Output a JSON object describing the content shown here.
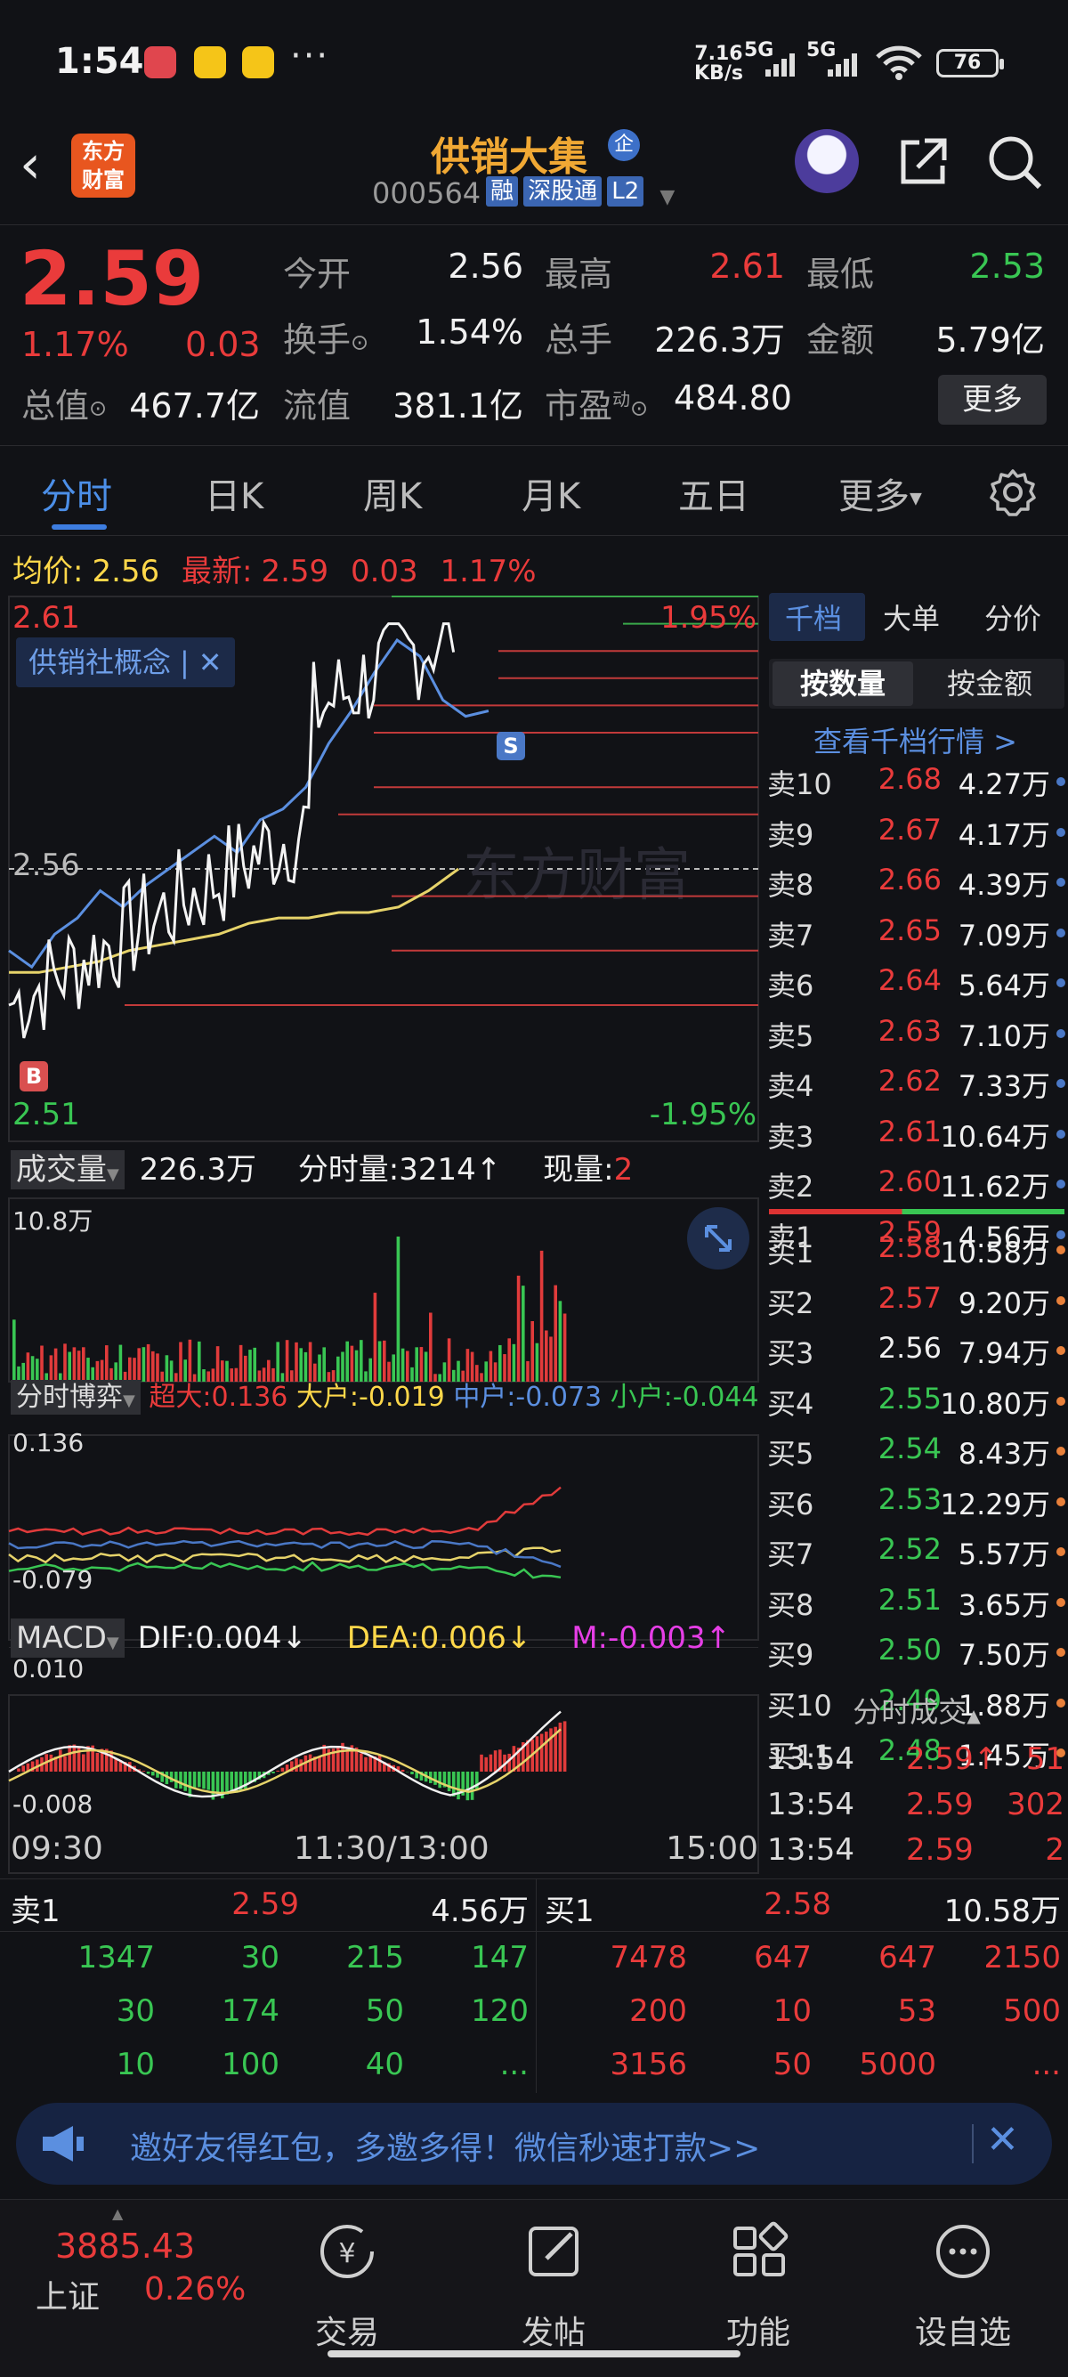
{
  "status_bar": {
    "time": "1:54",
    "net_speed": "7.16",
    "net_unit": "KB/s",
    "signal1": "5G",
    "signal2": "5G",
    "battery": "76"
  },
  "header": {
    "stock_name": "供销大集",
    "badge": "企",
    "code": "000564",
    "tags": [
      "融",
      "深股通",
      "L2"
    ]
  },
  "logo": {
    "line1": "东方",
    "line2": "财富"
  },
  "quote": {
    "price": "2.59",
    "change_pct": "1.17%",
    "change": "0.03",
    "open_label": "今开",
    "open": "2.56",
    "high_label": "最高",
    "high": "2.61",
    "low_label": "最低",
    "low": "2.53",
    "turnover_label": "换手",
    "turnover": "1.54%",
    "volume_label": "总手",
    "volume": "226.3万",
    "amount_label": "金额",
    "amount": "5.79亿",
    "mktcap_label": "总值",
    "mktcap": "467.7亿",
    "float_label": "流值",
    "float": "381.1亿",
    "pe_label": "市盈",
    "pe_sup": "动",
    "pe": "484.80",
    "more_label": "更多"
  },
  "tabs": [
    "分时",
    "日K",
    "周K",
    "月K",
    "五日",
    "更多"
  ],
  "avg_row": {
    "avg_label": "均价:",
    "avg": "2.56",
    "latest_label": "最新:",
    "latest": "2.59",
    "change": "0.03",
    "pct": "1.17%"
  },
  "price_chart": {
    "y_high": "2.61",
    "y_mid": "2.56",
    "y_low": "2.51",
    "pct_high": "1.95%",
    "pct_low": "-1.95%",
    "concept_tag": "供销社概念",
    "buy_marker": "B",
    "sell_marker": "S",
    "watermark": "东方财富"
  },
  "volume_panel": {
    "label": "成交量",
    "total": "226.3万",
    "tick_label": "分时量:",
    "tick": "3214",
    "tick_arrow": "↑",
    "current_label": "现量:",
    "current": "2",
    "ymax": "10.8万"
  },
  "flow_panel": {
    "label": "分时博弈",
    "super": "超大:0.136",
    "large": "大户:-0.019",
    "medium": "中户:-0.073",
    "small": "小户:-0.044",
    "ymax": "0.136",
    "ymin": "-0.079"
  },
  "macd_panel": {
    "label": "MACD",
    "dif": "DIF:0.004↓",
    "dea": "DEA:0.006↓",
    "m": "M:-0.003↑",
    "ymax": "0.010",
    "ymin": "-0.008"
  },
  "time_axis": [
    "09:30",
    "11:30/13:00",
    "15:00"
  ],
  "chart_data": {
    "type": "line",
    "x_range": [
      "09:30",
      "15:00"
    ],
    "ylim": [
      2.51,
      2.61
    ],
    "prev_close": 2.56,
    "series": [
      {
        "values": [
          2.545,
          2.542,
          2.548,
          2.551,
          2.556,
          2.553,
          2.557,
          2.56,
          2.563,
          2.566,
          2.563,
          2.569,
          2.571,
          2.575,
          2.583,
          2.589,
          2.596,
          2.602,
          2.599,
          2.591,
          2.588,
          2.589
        ]
      },
      {
        "values": [
          2.541,
          2.541,
          2.542,
          2.543,
          2.545,
          2.546,
          2.547,
          2.548,
          2.55,
          2.551,
          2.551,
          2.552,
          2.552,
          2.553,
          2.556,
          2.56
        ]
      }
    ],
    "volume_max": "10.8万",
    "macd": {
      "dif": 0.004,
      "dea": 0.006,
      "m": -0.003
    }
  },
  "order_book": {
    "tabs": [
      "千档",
      "大单",
      "分价"
    ],
    "toggle": [
      "按数量",
      "按金额"
    ],
    "view_link": "查看千档行情 >",
    "asks": [
      {
        "label": "卖10",
        "price": "2.68",
        "vol": "4.27万"
      },
      {
        "label": "卖9",
        "price": "2.67",
        "vol": "4.17万"
      },
      {
        "label": "卖8",
        "price": "2.66",
        "vol": "4.39万"
      },
      {
        "label": "卖7",
        "price": "2.65",
        "vol": "7.09万"
      },
      {
        "label": "卖6",
        "price": "2.64",
        "vol": "5.64万"
      },
      {
        "label": "卖5",
        "price": "2.63",
        "vol": "7.10万"
      },
      {
        "label": "卖4",
        "price": "2.62",
        "vol": "7.33万"
      },
      {
        "label": "卖3",
        "price": "2.61",
        "vol": "10.64万"
      },
      {
        "label": "卖2",
        "price": "2.60",
        "vol": "11.62万"
      },
      {
        "label": "卖1",
        "price": "2.59",
        "vol": "4.56万"
      }
    ],
    "bids": [
      {
        "label": "买1",
        "price": "2.58",
        "vol": "10.58万"
      },
      {
        "label": "买2",
        "price": "2.57",
        "vol": "9.20万"
      },
      {
        "label": "买3",
        "price": "2.56",
        "vol": "7.94万"
      },
      {
        "label": "买4",
        "price": "2.55",
        "vol": "10.80万"
      },
      {
        "label": "买5",
        "price": "2.54",
        "vol": "8.43万"
      },
      {
        "label": "买6",
        "price": "2.53",
        "vol": "12.29万"
      },
      {
        "label": "买7",
        "price": "2.52",
        "vol": "5.57万"
      },
      {
        "label": "买8",
        "price": "2.51",
        "vol": "3.65万"
      },
      {
        "label": "买9",
        "price": "2.50",
        "vol": "7.50万"
      },
      {
        "label": "买10",
        "price": "2.49",
        "vol": "1.88万"
      },
      {
        "label": "买11",
        "price": "2.48",
        "vol": "1.45万"
      }
    ],
    "trades_header": "分时成交",
    "trades": [
      {
        "time": "13:54",
        "price": "2.59↑",
        "vol": "51"
      },
      {
        "time": "13:54",
        "price": "2.59",
        "vol": "302"
      },
      {
        "time": "13:54",
        "price": "2.59",
        "vol": "2"
      }
    ]
  },
  "depth": {
    "sell_label": "卖1",
    "sell_price": "2.59",
    "sell_vol": "4.56万",
    "buy_label": "买1",
    "buy_price": "2.58",
    "buy_vol": "10.58万",
    "sell_queue": [
      [
        "1347",
        "30",
        "215",
        "147"
      ],
      [
        "30",
        "174",
        "50",
        "120"
      ],
      [
        "10",
        "100",
        "40",
        "..."
      ]
    ],
    "buy_queue": [
      [
        "7478",
        "647",
        "647",
        "2150"
      ],
      [
        "200",
        "10",
        "53",
        "500"
      ],
      [
        "3156",
        "50",
        "5000",
        "..."
      ]
    ]
  },
  "banner": {
    "text": "邀好友得红包，多邀多得！微信秒速打款>>"
  },
  "bottom_nav": {
    "index_value": "3885.43",
    "index_name": "上证",
    "index_pct": "0.26%",
    "items": [
      "交易",
      "发帖",
      "功能",
      "设自选"
    ]
  }
}
